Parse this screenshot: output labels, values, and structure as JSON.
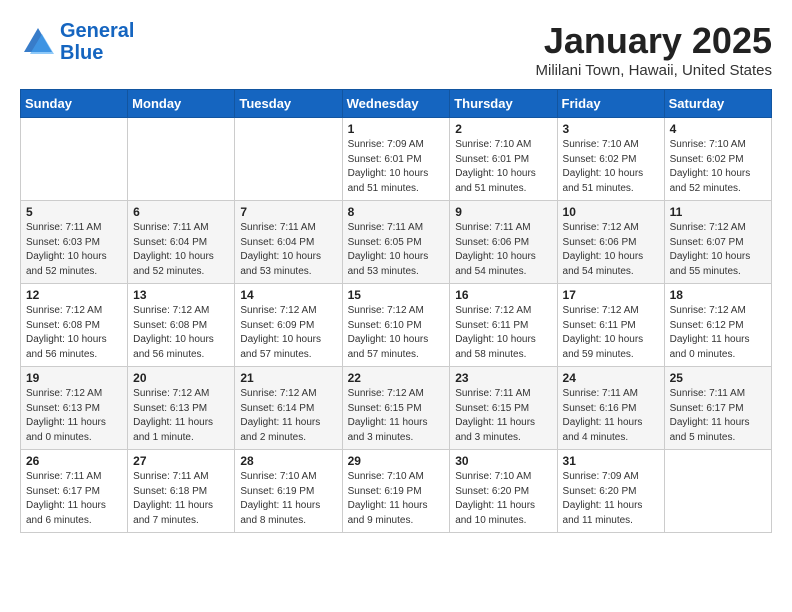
{
  "logo": {
    "line1": "General",
    "line2": "Blue"
  },
  "calendar": {
    "title": "January 2025",
    "subtitle": "Mililani Town, Hawaii, United States",
    "days_of_week": [
      "Sunday",
      "Monday",
      "Tuesday",
      "Wednesday",
      "Thursday",
      "Friday",
      "Saturday"
    ],
    "weeks": [
      [
        {
          "day": "",
          "info": ""
        },
        {
          "day": "",
          "info": ""
        },
        {
          "day": "",
          "info": ""
        },
        {
          "day": "1",
          "info": "Sunrise: 7:09 AM\nSunset: 6:01 PM\nDaylight: 10 hours\nand 51 minutes."
        },
        {
          "day": "2",
          "info": "Sunrise: 7:10 AM\nSunset: 6:01 PM\nDaylight: 10 hours\nand 51 minutes."
        },
        {
          "day": "3",
          "info": "Sunrise: 7:10 AM\nSunset: 6:02 PM\nDaylight: 10 hours\nand 51 minutes."
        },
        {
          "day": "4",
          "info": "Sunrise: 7:10 AM\nSunset: 6:02 PM\nDaylight: 10 hours\nand 52 minutes."
        }
      ],
      [
        {
          "day": "5",
          "info": "Sunrise: 7:11 AM\nSunset: 6:03 PM\nDaylight: 10 hours\nand 52 minutes."
        },
        {
          "day": "6",
          "info": "Sunrise: 7:11 AM\nSunset: 6:04 PM\nDaylight: 10 hours\nand 52 minutes."
        },
        {
          "day": "7",
          "info": "Sunrise: 7:11 AM\nSunset: 6:04 PM\nDaylight: 10 hours\nand 53 minutes."
        },
        {
          "day": "8",
          "info": "Sunrise: 7:11 AM\nSunset: 6:05 PM\nDaylight: 10 hours\nand 53 minutes."
        },
        {
          "day": "9",
          "info": "Sunrise: 7:11 AM\nSunset: 6:06 PM\nDaylight: 10 hours\nand 54 minutes."
        },
        {
          "day": "10",
          "info": "Sunrise: 7:12 AM\nSunset: 6:06 PM\nDaylight: 10 hours\nand 54 minutes."
        },
        {
          "day": "11",
          "info": "Sunrise: 7:12 AM\nSunset: 6:07 PM\nDaylight: 10 hours\nand 55 minutes."
        }
      ],
      [
        {
          "day": "12",
          "info": "Sunrise: 7:12 AM\nSunset: 6:08 PM\nDaylight: 10 hours\nand 56 minutes."
        },
        {
          "day": "13",
          "info": "Sunrise: 7:12 AM\nSunset: 6:08 PM\nDaylight: 10 hours\nand 56 minutes."
        },
        {
          "day": "14",
          "info": "Sunrise: 7:12 AM\nSunset: 6:09 PM\nDaylight: 10 hours\nand 57 minutes."
        },
        {
          "day": "15",
          "info": "Sunrise: 7:12 AM\nSunset: 6:10 PM\nDaylight: 10 hours\nand 57 minutes."
        },
        {
          "day": "16",
          "info": "Sunrise: 7:12 AM\nSunset: 6:11 PM\nDaylight: 10 hours\nand 58 minutes."
        },
        {
          "day": "17",
          "info": "Sunrise: 7:12 AM\nSunset: 6:11 PM\nDaylight: 10 hours\nand 59 minutes."
        },
        {
          "day": "18",
          "info": "Sunrise: 7:12 AM\nSunset: 6:12 PM\nDaylight: 11 hours\nand 0 minutes."
        }
      ],
      [
        {
          "day": "19",
          "info": "Sunrise: 7:12 AM\nSunset: 6:13 PM\nDaylight: 11 hours\nand 0 minutes."
        },
        {
          "day": "20",
          "info": "Sunrise: 7:12 AM\nSunset: 6:13 PM\nDaylight: 11 hours\nand 1 minute."
        },
        {
          "day": "21",
          "info": "Sunrise: 7:12 AM\nSunset: 6:14 PM\nDaylight: 11 hours\nand 2 minutes."
        },
        {
          "day": "22",
          "info": "Sunrise: 7:12 AM\nSunset: 6:15 PM\nDaylight: 11 hours\nand 3 minutes."
        },
        {
          "day": "23",
          "info": "Sunrise: 7:11 AM\nSunset: 6:15 PM\nDaylight: 11 hours\nand 3 minutes."
        },
        {
          "day": "24",
          "info": "Sunrise: 7:11 AM\nSunset: 6:16 PM\nDaylight: 11 hours\nand 4 minutes."
        },
        {
          "day": "25",
          "info": "Sunrise: 7:11 AM\nSunset: 6:17 PM\nDaylight: 11 hours\nand 5 minutes."
        }
      ],
      [
        {
          "day": "26",
          "info": "Sunrise: 7:11 AM\nSunset: 6:17 PM\nDaylight: 11 hours\nand 6 minutes."
        },
        {
          "day": "27",
          "info": "Sunrise: 7:11 AM\nSunset: 6:18 PM\nDaylight: 11 hours\nand 7 minutes."
        },
        {
          "day": "28",
          "info": "Sunrise: 7:10 AM\nSunset: 6:19 PM\nDaylight: 11 hours\nand 8 minutes."
        },
        {
          "day": "29",
          "info": "Sunrise: 7:10 AM\nSunset: 6:19 PM\nDaylight: 11 hours\nand 9 minutes."
        },
        {
          "day": "30",
          "info": "Sunrise: 7:10 AM\nSunset: 6:20 PM\nDaylight: 11 hours\nand 10 minutes."
        },
        {
          "day": "31",
          "info": "Sunrise: 7:09 AM\nSunset: 6:20 PM\nDaylight: 11 hours\nand 11 minutes."
        },
        {
          "day": "",
          "info": ""
        }
      ]
    ]
  }
}
